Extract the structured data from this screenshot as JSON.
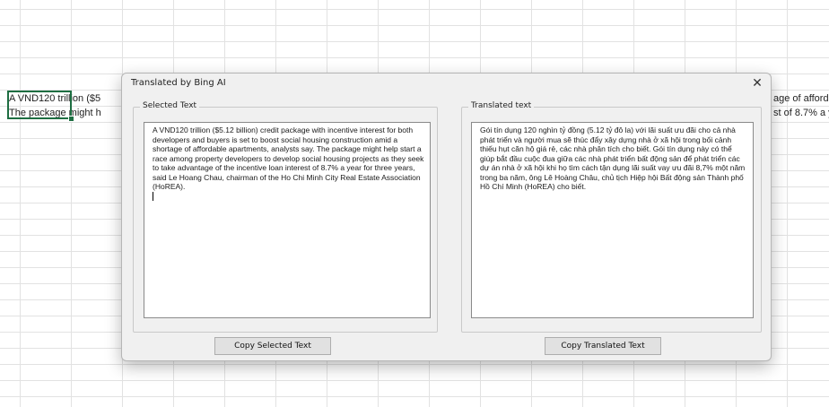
{
  "sheet": {
    "cell_row1_left": "A VND120 trillion ($5",
    "cell_row2_left": "The package might h",
    "cell_row1_right": "age of afford",
    "cell_row2_right": "st of 8.7% a y"
  },
  "dialog": {
    "title": "Translated by Bing AI",
    "close_symbol": "✕",
    "selected_group_label": "Selected Text",
    "translated_group_label": "Translated text",
    "selected_text": "A VND120 trillion ($5.12 billion) credit package with incentive interest for both developers and buyers is set to boost social housing construction amid a shortage of affordable apartments, analysts say. The package might help start a race among property developers to develop social housing projects as they seek to take advantage of the incentive loan interest of 8.7% a year for three years, said Le Hoang Chau, chairman of the Ho Chi Minh City Real Estate Association (HoREA).",
    "translated_text": "Gói tín dụng 120 nghìn tỷ đồng (5.12 tỷ đô la) với lãi suất ưu đãi cho cả nhà phát triển và người mua sẽ thúc đẩy xây dựng nhà ở xã hội trong bối cảnh thiếu hụt căn hộ giá rẻ, các nhà phân tích cho biết. Gói tín dụng này có thể giúp bắt đầu cuộc đua giữa các nhà phát triển bất động sản để phát triển các dự án nhà ở xã hội khi họ tìm cách tận dụng lãi suất vay ưu đãi 8,7% một năm trong ba năm, ông Lê Hoàng Châu, chủ tịch Hiệp hội Bất động sản Thành phố Hồ Chí Minh (HoREA) cho biết.",
    "copy_selected_label": "Copy Selected Text",
    "copy_translated_label": "Copy Translated Text"
  }
}
